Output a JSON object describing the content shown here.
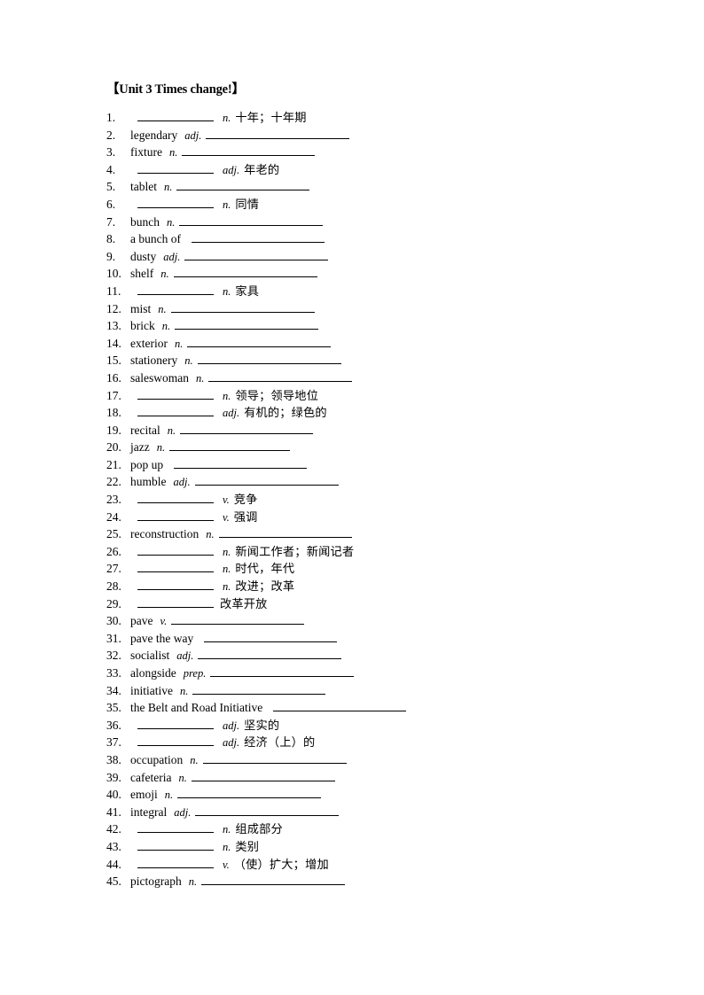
{
  "document": {
    "title": "【Unit 3 Times change!】",
    "unit_label": "Unit 3 Times change!"
  },
  "vocabulary": {
    "items": [
      {
        "num": "1.",
        "word": "",
        "pos": "n.",
        "cn": "十年；十年期",
        "layout": "blank-first"
      },
      {
        "num": "2.",
        "word": "legendary",
        "pos": "adj.",
        "cn": "",
        "layout": "blank-last",
        "blank": "long"
      },
      {
        "num": "3.",
        "word": "fixture",
        "pos": "n.",
        "cn": "",
        "layout": "blank-last",
        "blank": "normal"
      },
      {
        "num": "4.",
        "word": "",
        "pos": "adj.",
        "cn": "年老的",
        "layout": "blank-first"
      },
      {
        "num": "5.",
        "word": "tablet",
        "pos": "n.",
        "cn": "",
        "layout": "blank-last",
        "blank": "normal"
      },
      {
        "num": "6.",
        "word": "",
        "pos": "n.",
        "cn": "同情",
        "layout": "blank-first"
      },
      {
        "num": "7.",
        "word": "bunch",
        "pos": "n.",
        "cn": "",
        "layout": "blank-last",
        "blank": "long"
      },
      {
        "num": "8.",
        "word": "a bunch of",
        "pos": "",
        "cn": "",
        "layout": "phrase-blank",
        "blank": "long"
      },
      {
        "num": "9.",
        "word": "dusty",
        "pos": "adj.",
        "cn": "",
        "layout": "blank-last",
        "blank": "long"
      },
      {
        "num": "10.",
        "word": "shelf",
        "pos": "n.",
        "cn": "",
        "layout": "blank-last",
        "blank": "long"
      },
      {
        "num": "11.",
        "word": "",
        "pos": "n.",
        "cn": "家具",
        "layout": "blank-first"
      },
      {
        "num": "12.",
        "word": "mist",
        "pos": "n.",
        "cn": "",
        "layout": "blank-last",
        "blank": "long"
      },
      {
        "num": "13.",
        "word": "brick",
        "pos": "n.",
        "cn": "",
        "layout": "blank-last",
        "blank": "long"
      },
      {
        "num": "14.",
        "word": "exterior",
        "pos": "n.",
        "cn": "",
        "layout": "blank-last",
        "blank": "long"
      },
      {
        "num": "15.",
        "word": "stationery",
        "pos": "n.",
        "cn": "",
        "layout": "blank-last",
        "blank": "long"
      },
      {
        "num": "16.",
        "word": "saleswoman",
        "pos": "n.",
        "cn": "",
        "layout": "blank-last",
        "blank": "long"
      },
      {
        "num": "17.",
        "word": "",
        "pos": "n.",
        "cn": "领导；领导地位",
        "layout": "blank-first"
      },
      {
        "num": "18.",
        "word": "",
        "pos": "adj.",
        "cn": "有机的；绿色的",
        "layout": "blank-first"
      },
      {
        "num": "19.",
        "word": "recital",
        "pos": "n.",
        "cn": "",
        "layout": "blank-last",
        "blank": "normal"
      },
      {
        "num": "20.",
        "word": "jazz",
        "pos": "n.",
        "cn": "",
        "layout": "blank-last",
        "blank": "short"
      },
      {
        "num": "21.",
        "word": "pop up",
        "pos": "",
        "cn": "",
        "layout": "phrase-blank",
        "blank": "normal"
      },
      {
        "num": "22.",
        "word": "humble",
        "pos": "adj.",
        "cn": "",
        "layout": "blank-last",
        "blank": "long"
      },
      {
        "num": "23.",
        "word": "",
        "pos": "v.",
        "cn": "竞争",
        "layout": "blank-first"
      },
      {
        "num": "24.",
        "word": "",
        "pos": "v.",
        "cn": "强调",
        "layout": "blank-first"
      },
      {
        "num": "25.",
        "word": "reconstruction",
        "pos": "n.",
        "cn": "",
        "layout": "blank-last",
        "blank": "normal"
      },
      {
        "num": "26.",
        "word": "",
        "pos": "n.",
        "cn": "新闻工作者；新闻记者",
        "layout": "blank-first"
      },
      {
        "num": "27.",
        "word": "",
        "pos": "n.",
        "cn": "时代，年代",
        "layout": "blank-first"
      },
      {
        "num": "28.",
        "word": "",
        "pos": "n.",
        "cn": "改进；改革",
        "layout": "blank-first"
      },
      {
        "num": "29.",
        "word": "",
        "pos": "",
        "cn": "改革开放",
        "layout": "blank-first-nopos"
      },
      {
        "num": "30.",
        "word": "pave",
        "pos": "v.",
        "cn": "",
        "layout": "blank-last",
        "blank": "normal"
      },
      {
        "num": "31.",
        "word": "pave the way",
        "pos": "",
        "cn": "",
        "layout": "phrase-blank",
        "blank": "normal"
      },
      {
        "num": "32.",
        "word": "socialist",
        "pos": "adj.",
        "cn": "",
        "layout": "blank-last",
        "blank": "long"
      },
      {
        "num": "33.",
        "word": "alongside",
        "pos": "prep.",
        "cn": "",
        "layout": "blank-last",
        "blank": "long"
      },
      {
        "num": "34.",
        "word": "initiative",
        "pos": "n.",
        "cn": "",
        "layout": "blank-last",
        "blank": "normal"
      },
      {
        "num": "35.",
        "word": "the Belt and Road Initiative",
        "pos": "",
        "cn": "",
        "layout": "phrase-blank",
        "blank": "xlong"
      },
      {
        "num": "36.",
        "word": "",
        "pos": "adj.",
        "cn": "坚实的",
        "layout": "blank-first"
      },
      {
        "num": "37.",
        "word": "",
        "pos": "adj.",
        "cn": "经济（上）的",
        "layout": "blank-first"
      },
      {
        "num": "38.",
        "word": "occupation",
        "pos": "n.",
        "cn": "",
        "layout": "blank-last",
        "blank": "long"
      },
      {
        "num": "39.",
        "word": "cafeteria",
        "pos": "n.",
        "cn": "",
        "layout": "blank-last",
        "blank": "long"
      },
      {
        "num": "40.",
        "word": "emoji",
        "pos": "n.",
        "cn": "",
        "layout": "blank-last",
        "blank": "long"
      },
      {
        "num": "41.",
        "word": "integral",
        "pos": "adj.",
        "cn": "",
        "layout": "blank-last",
        "blank": "long"
      },
      {
        "num": "42.",
        "word": "",
        "pos": "n.",
        "cn": "组成部分",
        "layout": "blank-first"
      },
      {
        "num": "43.",
        "word": "",
        "pos": "n.",
        "cn": "类别",
        "layout": "blank-first"
      },
      {
        "num": "44.",
        "word": "",
        "pos": "v.",
        "cn": "（使）扩大；增加",
        "layout": "blank-first"
      },
      {
        "num": "45.",
        "word": "pictograph",
        "pos": "n.",
        "cn": "",
        "layout": "blank-last",
        "blank": "long"
      }
    ]
  }
}
